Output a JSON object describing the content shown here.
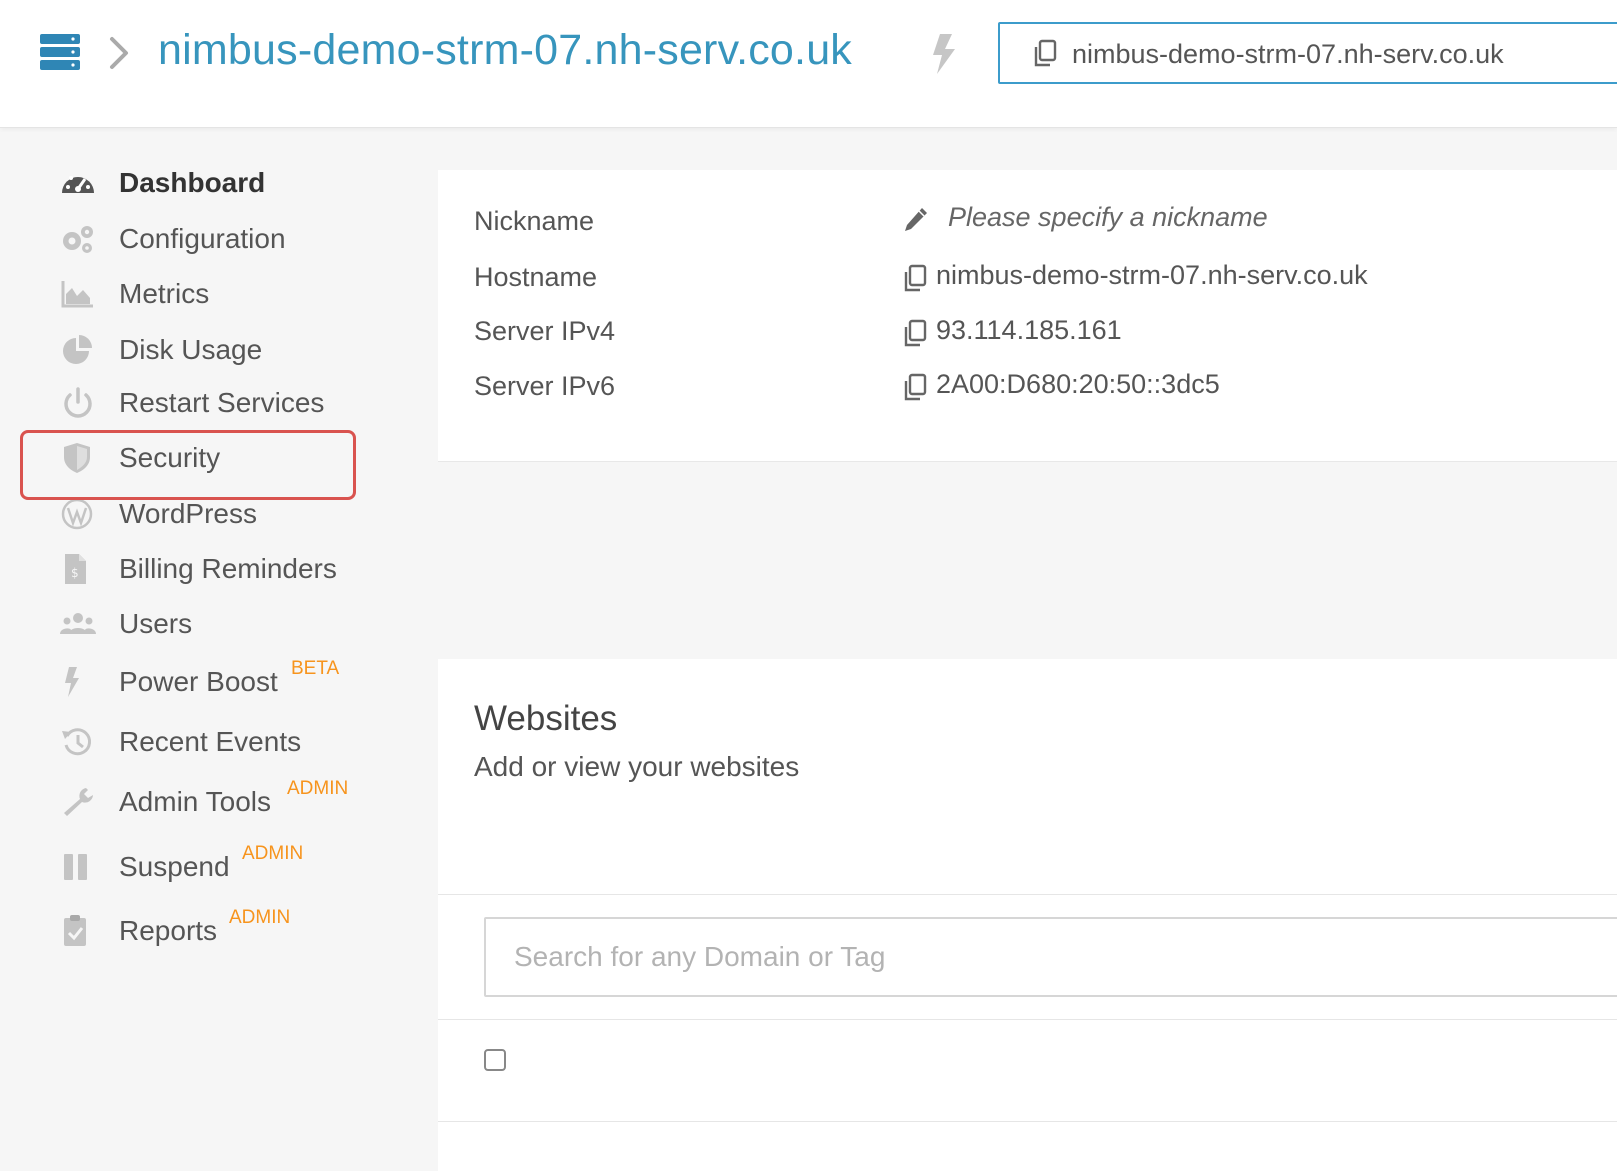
{
  "header": {
    "server_name": "nimbus-demo-strm-07.nh-serv.co.uk",
    "hostname_box": "nimbus-demo-strm-07.nh-serv.co.uk",
    "icons": [
      "server-icon",
      "chevron-right-icon",
      "bolt-icon",
      "copy-icon"
    ]
  },
  "sidebar": {
    "items": [
      {
        "label": "Dashboard",
        "icon": "dashboard-icon",
        "active": true
      },
      {
        "label": "Configuration",
        "icon": "gears-icon"
      },
      {
        "label": "Metrics",
        "icon": "area-chart-icon"
      },
      {
        "label": "Disk Usage",
        "icon": "pie-chart-icon"
      },
      {
        "label": "Restart Services",
        "icon": "power-icon"
      },
      {
        "label": "Security",
        "icon": "shield-icon",
        "highlighted": true
      },
      {
        "label": "WordPress",
        "icon": "wordpress-icon"
      },
      {
        "label": "Billing Reminders",
        "icon": "invoice-icon"
      },
      {
        "label": "Users",
        "icon": "users-icon"
      },
      {
        "label": "Power Boost",
        "icon": "bolt-icon",
        "tag": "BETA"
      },
      {
        "label": "Recent Events",
        "icon": "history-icon"
      },
      {
        "label": "Admin Tools",
        "icon": "wrench-icon",
        "tag": "ADMIN"
      },
      {
        "label": "Suspend",
        "icon": "pause-icon",
        "tag": "ADMIN"
      },
      {
        "label": "Reports",
        "icon": "clipboard-check-icon",
        "tag": "ADMIN"
      }
    ]
  },
  "server_info": {
    "nickname_label": "Nickname",
    "nickname_placeholder": "Please specify a nickname",
    "hostname_label": "Hostname",
    "hostname_value": "nimbus-demo-strm-07.nh-serv.co.uk",
    "ipv4_label": "Server IPv4",
    "ipv4_value": "93.114.185.161",
    "ipv6_label": "Server IPv6",
    "ipv6_value": "2A00:D680:20:50::3dc5"
  },
  "websites": {
    "title": "Websites",
    "subtitle": "Add or view your websites",
    "search_placeholder": "Search for any Domain or Tag"
  },
  "colors": {
    "accent": "#3795bd",
    "tag": "#f7941d",
    "highlight": "#d9534f",
    "icon_gray": "#bdbdbd",
    "icon_dark": "#555555"
  }
}
